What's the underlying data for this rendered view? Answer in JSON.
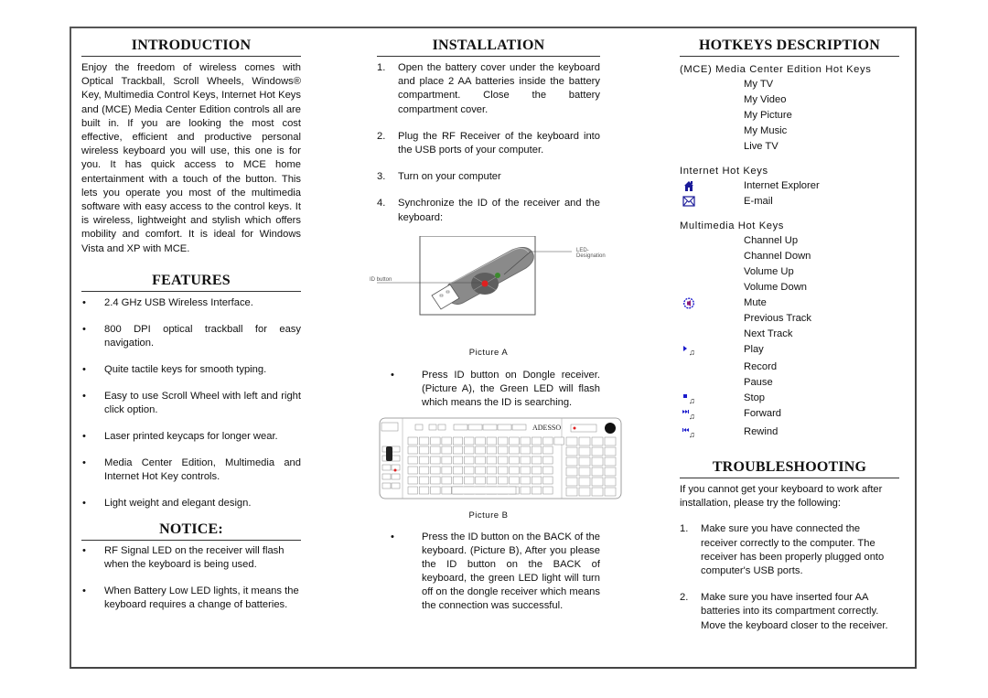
{
  "introduction": {
    "title": "INTRODUCTION",
    "text": "Enjoy the freedom of wireless comes with Optical Trackball, Scroll Wheels, Windows® Key, Multimedia Control Keys, Internet Hot Keys and (MCE) Media Center Edition controls all are built in. If you are looking the most cost effective, efficient and productive personal wireless keyboard you will use, this one is for you. It has quick access to MCE home entertainment with a touch of the button. This lets you operate you most of the multimedia software with easy access to the control keys. It is wireless, lightweight and stylish which offers mobility and comfort. It is ideal for Windows Vista and XP with MCE."
  },
  "features": {
    "title": "FEATURES",
    "items": [
      "2.4 GHz USB Wireless Interface.",
      "800 DPI optical trackball for easy navigation.",
      "Quite tactile keys for smooth typing.",
      "Easy to use Scroll Wheel with left and right click option.",
      "Laser printed keycaps for longer wear.",
      "Media Center Edition, Multimedia and Internet Hot Key controls.",
      "Light weight and elegant design."
    ]
  },
  "notice": {
    "title": "NOTICE:",
    "items": [
      "RF Signal LED on the receiver will flash when the keyboard is being used.",
      "When Battery Low LED lights, it means the keyboard requires a change of batteries."
    ]
  },
  "installation": {
    "title": "INSTALLATION",
    "steps": [
      "Open the battery cover under the keyboard and place 2 AA batteries inside the battery compartment. Close the battery compartment cover.",
      "Plug the RF Receiver of the keyboard into the USB ports of your computer.",
      "Turn on your computer",
      "Synchronize the ID of the receiver and the keyboard:"
    ],
    "picture_a": {
      "caption": "Picture A",
      "label_led": "LED- Designation",
      "label_id": "ID button",
      "led_color": "#3c8a2e",
      "button_color": "#e02020"
    },
    "bullet_a": "Press ID button on Dongle receiver. (Picture A), the Green LED will flash which means the ID is searching.",
    "picture_b": {
      "caption": "Picture B",
      "brand": "ADESSO"
    },
    "bullet_b": "Press the ID button on the BACK of the keyboard. (Picture B), After you please the ID button on the BACK of keyboard, the green LED light will turn off on the dongle receiver which means the connection was successful."
  },
  "hotkeys": {
    "title": "HOTKEYS DESCRIPTION",
    "groups": [
      {
        "heading": "(MCE) Media Center Edition Hot Keys",
        "items": [
          {
            "label": "My TV",
            "icon": ""
          },
          {
            "label": "My Video",
            "icon": ""
          },
          {
            "label": "My Picture",
            "icon": ""
          },
          {
            "label": "My Music",
            "icon": ""
          },
          {
            "label": "Live TV",
            "icon": ""
          }
        ]
      },
      {
        "heading": "Internet Hot Keys",
        "items": [
          {
            "label": "Internet Explorer",
            "icon": "home-icon"
          },
          {
            "label": "E-mail",
            "icon": "envelope-icon"
          }
        ]
      },
      {
        "heading": "Multimedia Hot Keys",
        "items": [
          {
            "label": "Channel Up",
            "icon": ""
          },
          {
            "label": "Channel Down",
            "icon": ""
          },
          {
            "label": "Volume Up",
            "icon": ""
          },
          {
            "label": "Volume Down",
            "icon": ""
          },
          {
            "label": "Mute",
            "icon": "mute-icon"
          },
          {
            "label": "Previous Track",
            "icon": ""
          },
          {
            "label": "Next Track",
            "icon": ""
          },
          {
            "label": "Play",
            "icon": "play-icon"
          },
          {
            "label": "Record",
            "icon": ""
          },
          {
            "label": "Pause",
            "icon": ""
          },
          {
            "label": "Stop",
            "icon": "stop-icon"
          },
          {
            "label": "Forward",
            "icon": "forward-icon"
          },
          {
            "label": "Rewind",
            "icon": "rewind-icon"
          }
        ]
      }
    ],
    "icon_color": "#1a1acc"
  },
  "troubleshooting": {
    "title": "TROUBLESHOOTING",
    "intro": "If you cannot get your keyboard to work after installation, please try the following:",
    "steps": [
      "Make sure you have connected the receiver correctly to the computer.  The receiver has been properly plugged onto computer's USB ports.",
      "Make sure you have inserted four AA batteries into its compartment correctly. Move the keyboard closer to the receiver."
    ]
  }
}
